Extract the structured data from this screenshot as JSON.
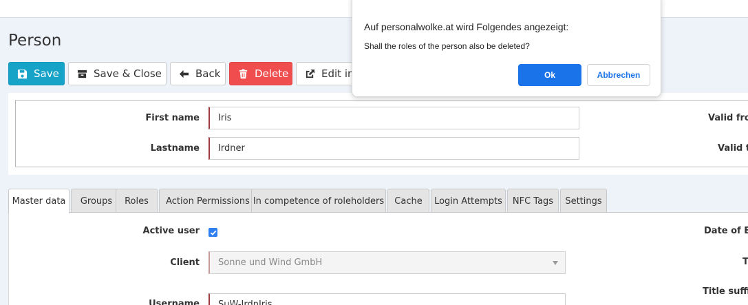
{
  "page": {
    "title": "Person"
  },
  "toolbar": {
    "save_label": "Save",
    "save_close_label": "Save & Close",
    "back_label": "Back",
    "delete_label": "Delete",
    "edit_label": "Edit in"
  },
  "header_form": {
    "first_name_label": "First name",
    "first_name_value": "Iris",
    "lastname_label": "Lastname",
    "lastname_value": "Irdner",
    "valid_from_label": "Valid fro",
    "valid_to_label": "Valid t"
  },
  "tabs": [
    {
      "label": "Master data",
      "active": true
    },
    {
      "label": "Groups"
    },
    {
      "label": "Roles"
    },
    {
      "label": "Action Permissions"
    },
    {
      "label": "In competence of roleholders"
    },
    {
      "label": "Cache"
    },
    {
      "label": "Login Attempts"
    },
    {
      "label": "NFC Tags"
    },
    {
      "label": "Settings"
    }
  ],
  "master_data": {
    "active_user_label": "Active user",
    "active_user_checked": true,
    "client_label": "Client",
    "client_value": "Sonne und Wind GmbH",
    "username_label": "Username",
    "username_value": "SuW-IrdnIris",
    "date_of_birth_label": "Date of Bi",
    "title_label": "T",
    "title_suffix_label": "Title suffix"
  },
  "dialog": {
    "title": "Auf personalwolke.at wird Folgendes angezeigt:",
    "message": "Shall the roles of the person also be deleted?",
    "ok_label": "Ok",
    "cancel_label": "Abbrechen"
  },
  "colors": {
    "primary": "#17a2c8",
    "danger": "#f04e4e",
    "dialog_accent": "#1a73e8"
  }
}
